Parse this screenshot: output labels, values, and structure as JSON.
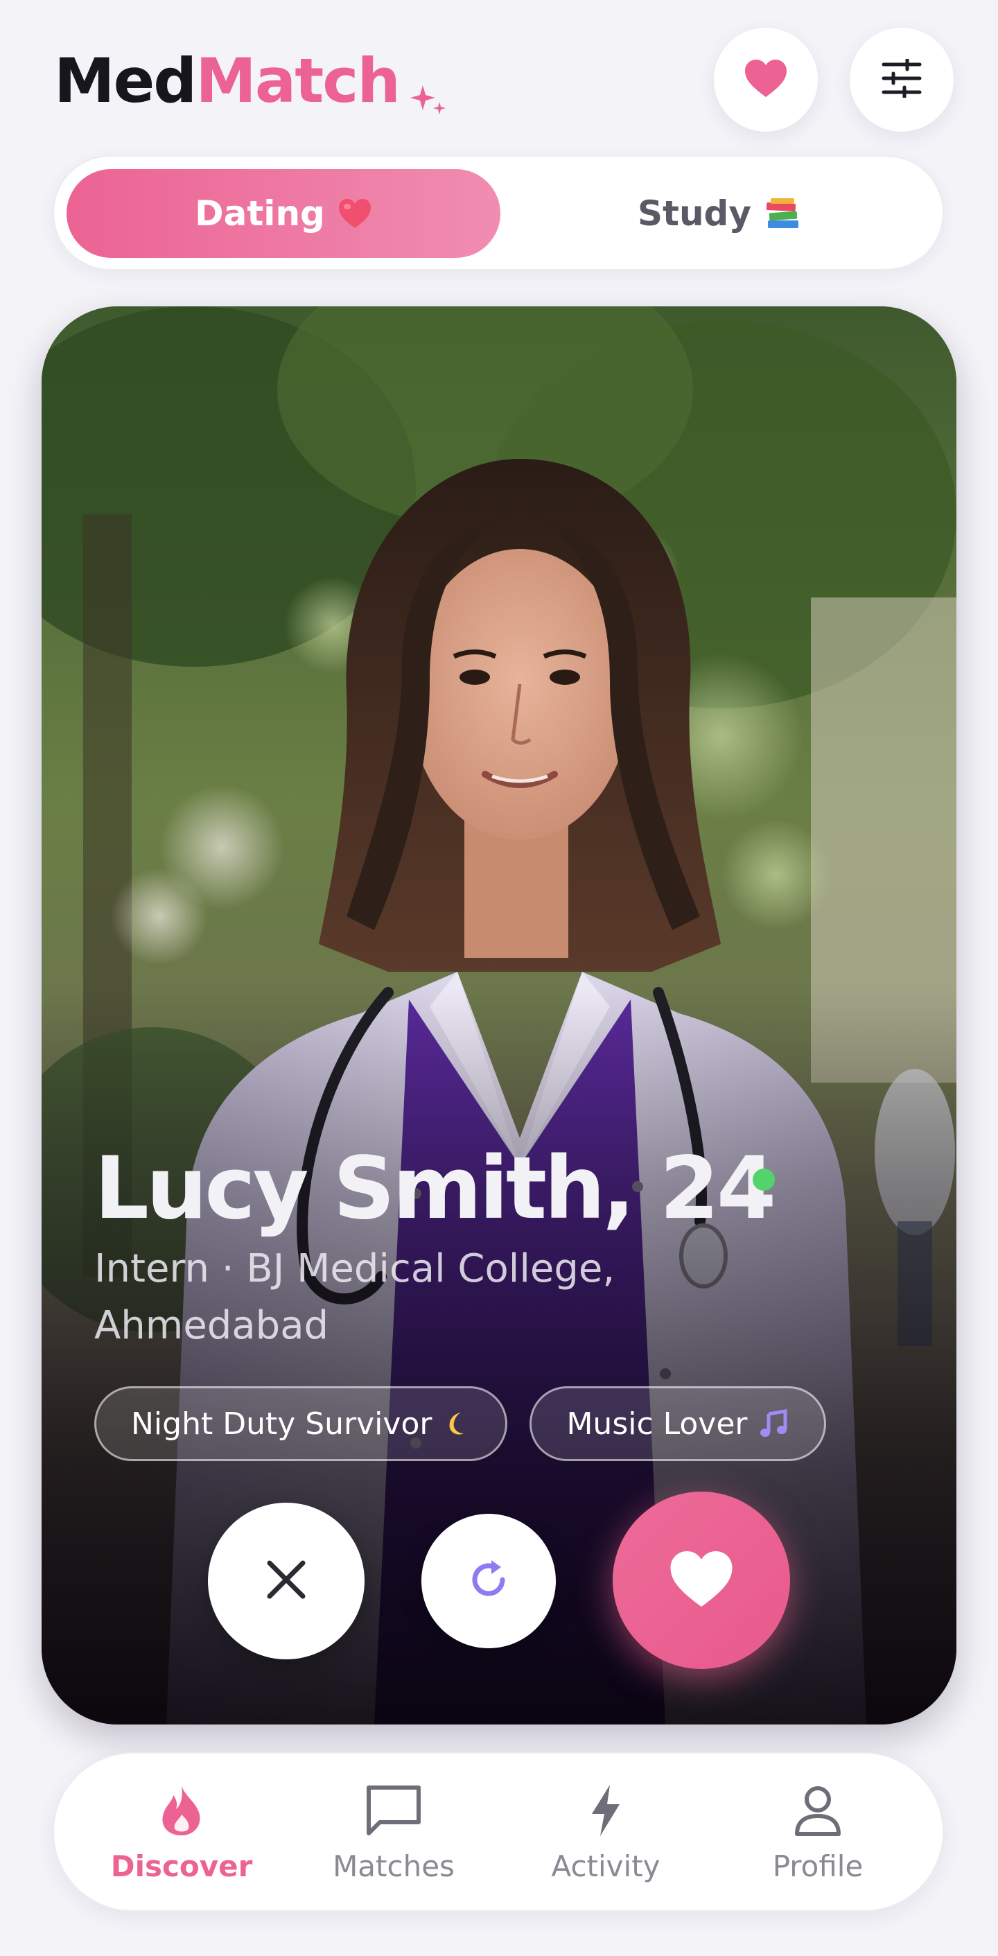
{
  "app": {
    "brand_part1": "Med",
    "brand_part2": "Match"
  },
  "header": {
    "favorites_icon": "heart-icon",
    "filters_icon": "sliders-icon"
  },
  "mode_toggle": {
    "dating_label": "Dating",
    "dating_emoji": "heart-emoji",
    "study_label": "Study",
    "study_emoji": "books-emoji",
    "selected": "Dating"
  },
  "profile": {
    "name_age": "Lucy Smith, 24",
    "online": true,
    "meta": "Intern  ·  BJ Medical College, Ahmedabad",
    "tags": [
      {
        "label": "Night Duty Survivor",
        "emoji": "crescent-moon-emoji"
      },
      {
        "label": "Music Lover",
        "emoji": "music-note-emoji"
      }
    ]
  },
  "actions": {
    "pass_icon": "close-icon",
    "rewind_icon": "rewind-icon",
    "like_icon": "heart-icon"
  },
  "bottom_nav": {
    "items": [
      {
        "label": "Discover",
        "icon": "flame-icon",
        "active": true
      },
      {
        "label": "Matches",
        "icon": "chat-icon",
        "active": false
      },
      {
        "label": "Activity",
        "icon": "bolt-icon",
        "active": false
      },
      {
        "label": "Profile",
        "icon": "user-icon",
        "active": false
      }
    ]
  },
  "colors": {
    "accent": "#ec6393",
    "background": "#f4f3f8",
    "online": "#52d46a",
    "rewind": "#8b7cf0"
  }
}
